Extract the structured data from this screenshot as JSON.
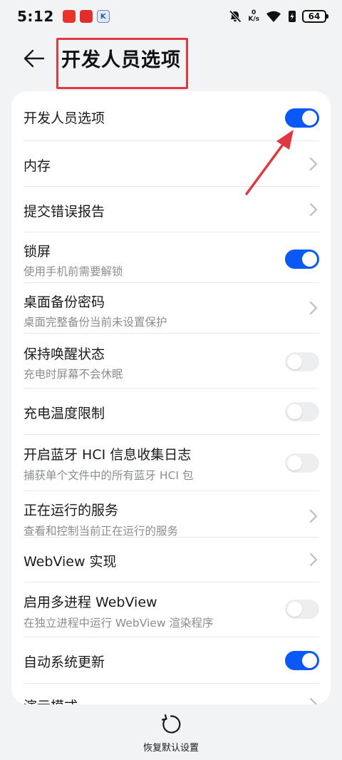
{
  "status": {
    "time": "5:12",
    "apps": [
      "拼多多",
      "小红书",
      "K"
    ],
    "speed_value": "0",
    "speed_unit": "K/s",
    "battery": "64"
  },
  "header": {
    "title": "开发人员选项"
  },
  "settings": [
    {
      "title": "开发人员选项",
      "type": "toggle",
      "state": "on"
    },
    {
      "title": "内存",
      "type": "link"
    },
    {
      "title": "提交错误报告",
      "type": "link"
    },
    {
      "title": "锁屏",
      "subtitle": "使用手机前需要解锁",
      "type": "toggle",
      "state": "on"
    },
    {
      "title": "桌面备份密码",
      "subtitle": "桌面完整备份当前未设置保护",
      "type": "link"
    },
    {
      "title": "保持唤醒状态",
      "subtitle": "充电时屏幕不会休眠",
      "type": "toggle",
      "state": "off"
    },
    {
      "title": "充电温度限制",
      "type": "toggle",
      "state": "off"
    },
    {
      "title": "开启蓝牙 HCI 信息收集日志",
      "subtitle": "捕获单个文件中的所有蓝牙 HCI 包",
      "type": "toggle",
      "state": "off"
    },
    {
      "title": "正在运行的服务",
      "subtitle": "查看和控制当前正在运行的服务",
      "type": "link"
    },
    {
      "title": "WebView 实现",
      "type": "link"
    },
    {
      "title": "启用多进程 WebView",
      "subtitle": "在独立进程中运行 WebView 渲染程序",
      "type": "toggle",
      "state": "off"
    },
    {
      "title": "自动系统更新",
      "type": "toggle",
      "state": "on"
    },
    {
      "title": "演示模式",
      "type": "link"
    }
  ],
  "bottom": {
    "reset_label": "恢复默认设置"
  },
  "colors": {
    "accent": "#0a59f7",
    "annotation": "#e0383e",
    "background": "#f1f3f5"
  }
}
